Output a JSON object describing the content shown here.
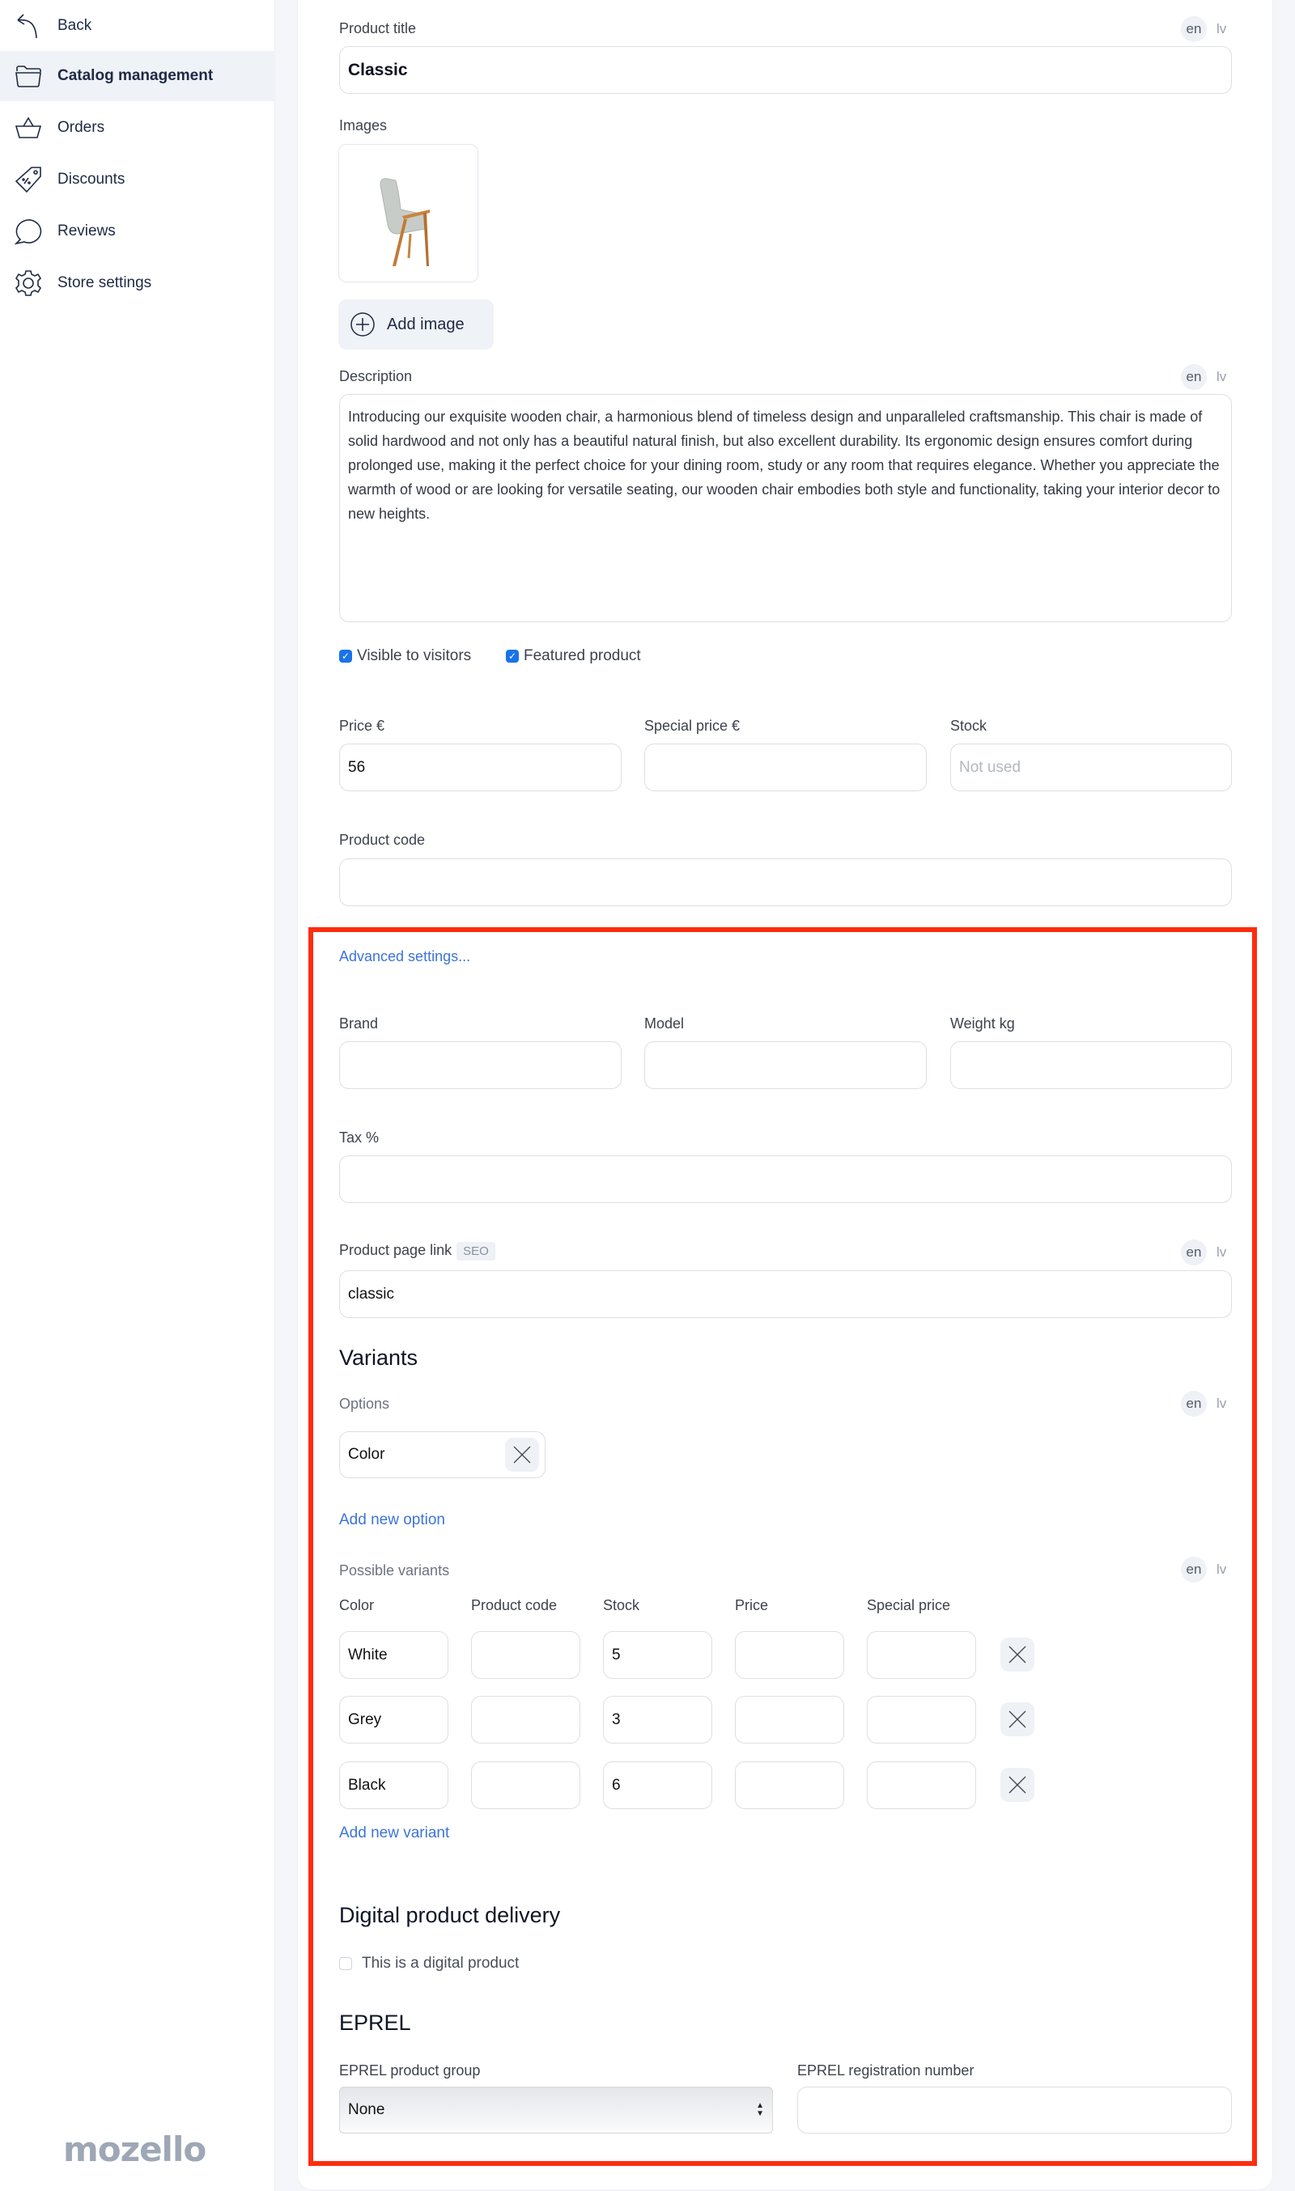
{
  "sidebar": {
    "items": [
      {
        "label": "Back",
        "icon": "back-arrow-icon"
      },
      {
        "label": "Catalog management",
        "icon": "folder-icon",
        "active": true
      },
      {
        "label": "Orders",
        "icon": "basket-icon"
      },
      {
        "label": "Discounts",
        "icon": "discount-tag-icon"
      },
      {
        "label": "Reviews",
        "icon": "speech-bubble-icon"
      },
      {
        "label": "Store settings",
        "icon": "gear-icon"
      }
    ],
    "logo": "mozello"
  },
  "languages": {
    "primary": "en",
    "secondary": "lv"
  },
  "form": {
    "product_title": {
      "label": "Product title",
      "value": "Classic"
    },
    "images": {
      "label": "Images",
      "add_label": "Add image"
    },
    "description": {
      "label": "Description",
      "value": "Introducing our exquisite wooden chair, a harmonious blend of timeless design and unparalleled craftsmanship. This chair is made of solid hardwood and not only has a beautiful natural finish, but also excellent durability. Its ergonomic design ensures comfort during prolonged use, making it the perfect choice for your dining room, study or any room that requires elegance. Whether you appreciate the warmth of wood or are looking for versatile seating, our wooden chair embodies both style and functionality, taking your interior decor to new heights."
    },
    "visible": {
      "label": "Visible to visitors",
      "checked": true
    },
    "featured": {
      "label": "Featured product",
      "checked": true
    },
    "price": {
      "label": "Price €",
      "value": "56"
    },
    "special_price": {
      "label": "Special price €",
      "value": ""
    },
    "stock": {
      "label": "Stock",
      "placeholder": "Not used"
    },
    "product_code": {
      "label": "Product code",
      "value": ""
    }
  },
  "advanced": {
    "link": "Advanced settings...",
    "brand": {
      "label": "Brand",
      "value": ""
    },
    "model": {
      "label": "Model",
      "value": ""
    },
    "weight": {
      "label": "Weight kg",
      "value": ""
    },
    "tax": {
      "label": "Tax %",
      "value": ""
    },
    "page_link": {
      "label": "Product page link",
      "badge": "SEO",
      "value": "classic"
    }
  },
  "variants": {
    "heading": "Variants",
    "options_label": "Options",
    "options": [
      {
        "value": "Color"
      }
    ],
    "add_option": "Add new option",
    "possible_label": "Possible variants",
    "columns": [
      "Color",
      "Product code",
      "Stock",
      "Price",
      "Special price"
    ],
    "rows": [
      {
        "color": "White",
        "code": "",
        "stock": "5",
        "price": "",
        "special": ""
      },
      {
        "color": "Grey",
        "code": "",
        "stock": "3",
        "price": "",
        "special": ""
      },
      {
        "color": "Black",
        "code": "",
        "stock": "6",
        "price": "",
        "special": ""
      }
    ],
    "add_variant": "Add new variant"
  },
  "digital": {
    "heading": "Digital product delivery",
    "checkbox_label": "This is a digital product",
    "checked": false
  },
  "eprel": {
    "heading": "EPREL",
    "group_label": "EPREL product group",
    "group_value": "None",
    "reg_label": "EPREL registration number",
    "reg_value": ""
  },
  "colors": {
    "accent_link": "#3d74d6",
    "highlight_box": "#ff2d0f",
    "checkbox": "#1a73e8"
  }
}
